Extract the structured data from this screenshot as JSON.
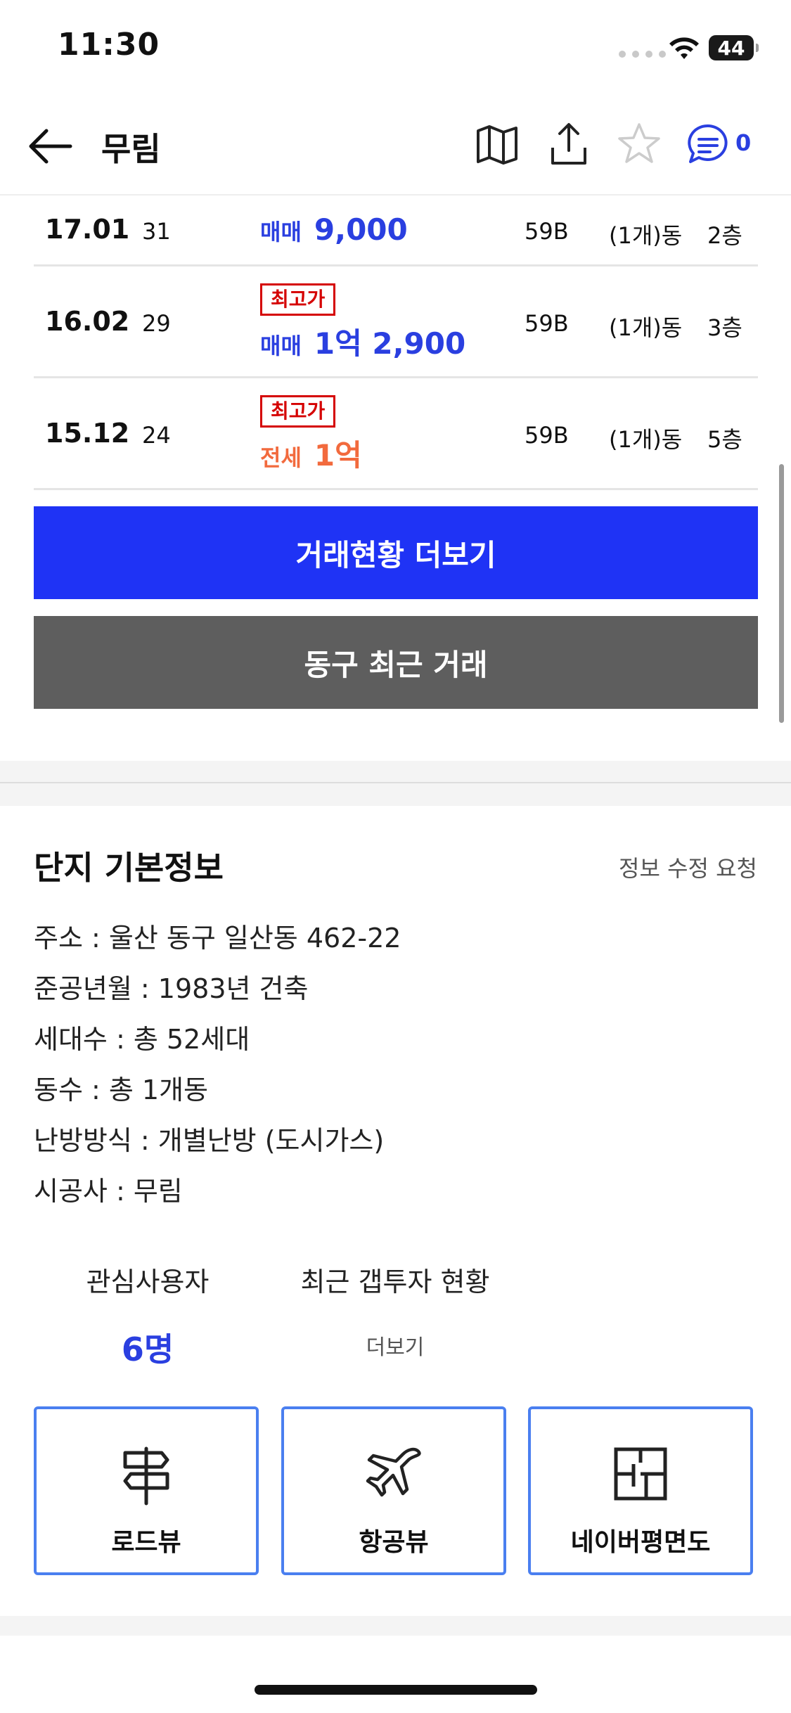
{
  "status_bar": {
    "time": "11:30",
    "battery": "44"
  },
  "nav": {
    "title": "무림",
    "chat_count": "0"
  },
  "trades": [
    {
      "date": "17.01",
      "count": "31",
      "badge": "",
      "type": "매매",
      "price": "9,000",
      "kind": "sale",
      "area": "59B",
      "dong": "(1개)동",
      "floor": "2층"
    },
    {
      "date": "16.02",
      "count": "29",
      "badge": "최고가",
      "type": "매매",
      "price": "1억 2,900",
      "kind": "sale",
      "area": "59B",
      "dong": "(1개)동",
      "floor": "3층"
    },
    {
      "date": "15.12",
      "count": "24",
      "badge": "최고가",
      "type": "전세",
      "price": "1억",
      "kind": "jeonse",
      "area": "59B",
      "dong": "(1개)동",
      "floor": "5층"
    }
  ],
  "buttons": {
    "more_trades": "거래현황 더보기",
    "recent_district": "동구 최근 거래"
  },
  "info": {
    "title": "단지 기본정보",
    "edit_request": "정보 수정 요청",
    "lines": [
      "주소 : 울산 동구 일산동 462-22",
      "준공년월 : 1983년 건축",
      "세대수 : 총 52세대",
      "동수 : 총 1개동",
      "난방방식 : 개별난방 (도시가스)",
      "시공사 : 무림"
    ]
  },
  "stats": {
    "interest_label": "관심사용자",
    "interest_value": "6명",
    "gap_label": "최근 갭투자 현황",
    "gap_more": "더보기"
  },
  "views": {
    "road": "로드뷰",
    "air": "항공뷰",
    "floorplan": "네이버평면도"
  },
  "colors": {
    "accent_blue": "#1f33f5",
    "text_blue": "#2a3fe0",
    "jeonse_orange": "#f26a3d",
    "badge_red": "#d50000",
    "gray_button": "#5e5e5e",
    "outline_blue": "#4a7ff0"
  }
}
